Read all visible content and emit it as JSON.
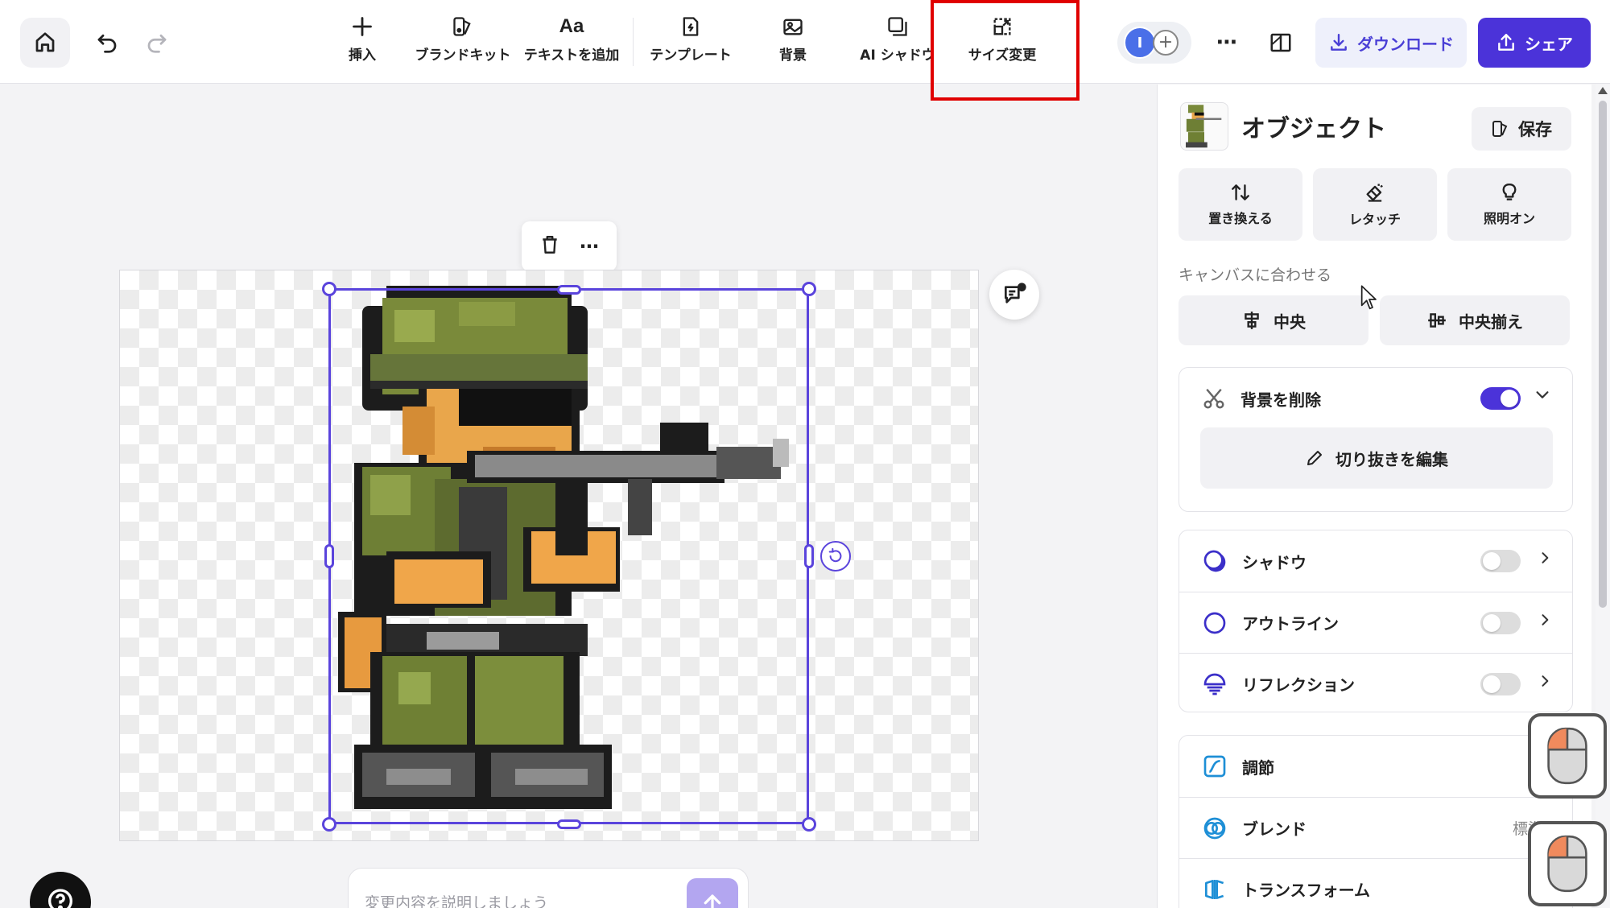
{
  "toolbar": {
    "tools": [
      {
        "id": "insert",
        "label": "挿入",
        "icon": "plus-icon"
      },
      {
        "id": "brand-kit",
        "label": "ブランドキット",
        "icon": "brand-kit-icon"
      },
      {
        "id": "add-text",
        "label": "テキストを追加",
        "icon": "text-icon"
      },
      {
        "id": "template",
        "label": "テンプレート",
        "icon": "template-icon"
      },
      {
        "id": "background",
        "label": "背景",
        "icon": "background-icon"
      },
      {
        "id": "ai-shadow",
        "label": "AI シャドウ",
        "icon": "ai-shadow-icon"
      },
      {
        "id": "resize",
        "label": "サイズ変更",
        "icon": "resize-icon"
      }
    ],
    "avatar_initial": "I",
    "download_label": "ダウンロード",
    "share_label": "シェア",
    "highlight_color": "#e00000",
    "accent_color": "#4b33d9"
  },
  "canvas": {
    "prompt_placeholder": "変更内容を説明しましょう",
    "selection_color": "#5a44dc"
  },
  "panel": {
    "title": "オブジェクト",
    "save_label": "保存",
    "actions": [
      {
        "label": "置き換える",
        "icon": "replace-icon"
      },
      {
        "label": "レタッチ",
        "icon": "retouch-eraser-icon"
      },
      {
        "label": "照明オン",
        "icon": "lightbulb-icon"
      }
    ],
    "fit_canvas_label": "キャンバスに合わせる",
    "align_buttons": [
      {
        "label": "中央",
        "icon": "align-center-horizontal-icon"
      },
      {
        "label": "中央揃え",
        "icon": "align-center-vertical-icon"
      }
    ],
    "remove_bg": {
      "label": "背景を削除",
      "enabled": true,
      "edit_cutout_label": "切り抜きを編集"
    },
    "effects": [
      {
        "label": "シャドウ",
        "enabled": false,
        "icon": "shadow-icon"
      },
      {
        "label": "アウトライン",
        "enabled": false,
        "icon": "outline-icon"
      },
      {
        "label": "リフレクション",
        "enabled": false,
        "icon": "reflection-icon"
      }
    ],
    "adjust_rows": [
      {
        "label": "調節",
        "icon": "adjust-curve-icon",
        "value": ""
      },
      {
        "label": "ブレンド",
        "icon": "blend-icon",
        "value": "標準"
      },
      {
        "label": "トランスフォーム",
        "icon": "transform-icon",
        "value": ""
      }
    ]
  }
}
